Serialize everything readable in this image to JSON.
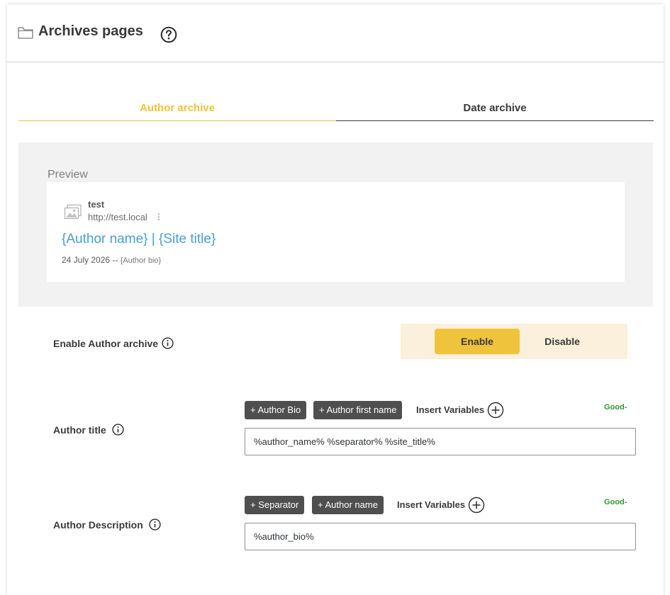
{
  "header": {
    "title": "Archives pages",
    "icon": "folder-icon",
    "help_icon": "help-circle-icon"
  },
  "tabs": [
    {
      "label": "Author archive",
      "active": true
    },
    {
      "label": "Date archive",
      "active": false
    }
  ],
  "preview": {
    "label": "Preview",
    "site_name": "test",
    "url": "http://test.local",
    "menu_glyph": "⋮",
    "title": "{Author name} | {Site title}",
    "date": "24 July 2026 --",
    "description": "{Author bio}"
  },
  "enable_row": {
    "label": "Enable Author archive",
    "enable_label": "Enable",
    "disable_label": "Disable",
    "selected": "Enable"
  },
  "author_title": {
    "label": "Author title",
    "chips": [
      "+ Author Bio",
      "+ Author first name"
    ],
    "insert_label": "Insert Variables",
    "status": "Good-",
    "value": "%author_name% %separator% %site_title%"
  },
  "author_description": {
    "label": "Author Description",
    "chips": [
      "+ Separator",
      "+ Author name"
    ],
    "insert_label": "Insert Variables",
    "status": "Good-",
    "value": "%author_bio%"
  },
  "colors": {
    "accent": "#f0c33c",
    "link": "#4a9fd1",
    "good": "#2e9a2e",
    "chip": "#4f4f4f",
    "toggle_bg": "#fbf0dc"
  }
}
